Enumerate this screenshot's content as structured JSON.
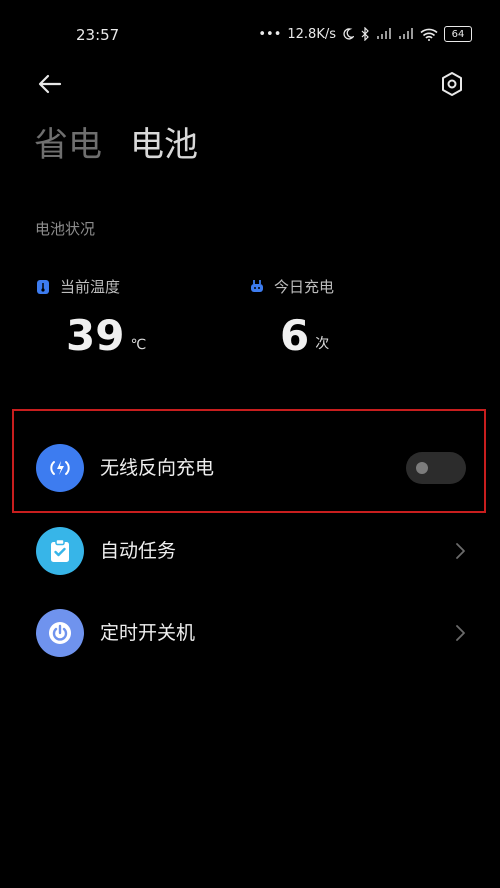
{
  "status_bar": {
    "time": "23:57",
    "network_speed": "12.8K/s",
    "battery_level": "64",
    "icons": [
      "dots-icon",
      "moon-icon",
      "bluetooth-icon",
      "signal-icon",
      "signal-icon",
      "wifi-icon",
      "battery-icon"
    ]
  },
  "nav": {
    "back_icon": "arrow-left-icon",
    "settings_icon": "gear-icon"
  },
  "tabs": [
    {
      "label": "省电",
      "active": false
    },
    {
      "label": "电池",
      "active": true
    }
  ],
  "battery_status": {
    "section_label": "电池状况",
    "temperature": {
      "label": "当前温度",
      "value": "39",
      "unit": "℃",
      "icon": "thermometer-icon"
    },
    "charges": {
      "label": "今日充电",
      "value": "6",
      "unit": "次",
      "icon": "plug-icon"
    }
  },
  "settings": [
    {
      "label": "无线反向充电",
      "icon": "wireless-charging-icon",
      "icon_color": "#3d7cf0",
      "control": "toggle",
      "toggle_on": false
    },
    {
      "label": "自动任务",
      "icon": "clipboard-check-icon",
      "icon_color": "#37b5e8",
      "control": "chevron"
    },
    {
      "label": "定时开关机",
      "icon": "power-icon",
      "icon_color": "#6f93ee",
      "control": "chevron"
    }
  ],
  "colors": {
    "background": "#000000",
    "highlight_border": "#c81e1e",
    "accent_blue": "#3d7cf0"
  }
}
